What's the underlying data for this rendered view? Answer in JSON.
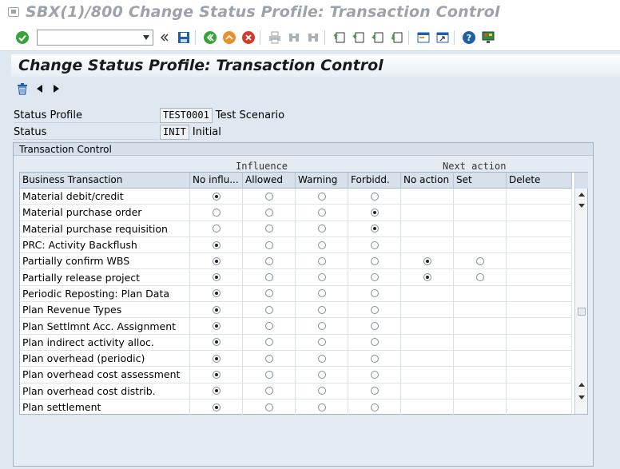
{
  "window": {
    "title": "SBX(1)/800 Change Status Profile: Transaction Control"
  },
  "toolbar": {
    "command_value": ""
  },
  "screen": {
    "title": "Change Status Profile: Transaction Control"
  },
  "fields": {
    "status_profile": {
      "label": "Status Profile",
      "value": "TEST0001",
      "desc": "Test Scenario"
    },
    "status": {
      "label": "Status",
      "value": "INIT",
      "desc": "Initial"
    }
  },
  "group": {
    "title": "Transaction Control",
    "influence_label": "Influence",
    "next_action_label": "Next action"
  },
  "table": {
    "headers": [
      "Business Transaction",
      "No influ...",
      "Allowed",
      "Warning",
      "Forbidd.",
      "No action",
      "Set",
      "Delete"
    ],
    "rows": [
      {
        "name": "Material debit/credit",
        "influence": 0,
        "next": null
      },
      {
        "name": "Material purchase order",
        "influence": 3,
        "next": null
      },
      {
        "name": "Material purchase requisition",
        "influence": 3,
        "next": null
      },
      {
        "name": "PRC: Activity Backflush",
        "influence": 0,
        "next": null
      },
      {
        "name": "Partially confirm WBS",
        "influence": 0,
        "next": 0
      },
      {
        "name": "Partially release project",
        "influence": 0,
        "next": 0
      },
      {
        "name": "Periodic Reposting: Plan Data",
        "influence": 0,
        "next": null
      },
      {
        "name": "Plan Revenue Types",
        "influence": 0,
        "next": null
      },
      {
        "name": "Plan Settlmnt Acc. Assignment",
        "influence": 0,
        "next": null
      },
      {
        "name": "Plan indirect activity alloc.",
        "influence": 0,
        "next": null
      },
      {
        "name": "Plan overhead (periodic)",
        "influence": 0,
        "next": null
      },
      {
        "name": "Plan overhead cost assessment",
        "influence": 0,
        "next": null
      },
      {
        "name": "Plan overhead cost distrib.",
        "influence": 0,
        "next": null
      },
      {
        "name": "Plan settlement",
        "influence": 0,
        "next": null
      }
    ]
  },
  "colors": {
    "accent_green": "#3aa23a",
    "accent_blue": "#1e5fa8",
    "accent_orange": "#e8912a",
    "accent_red": "#d23b2b"
  }
}
